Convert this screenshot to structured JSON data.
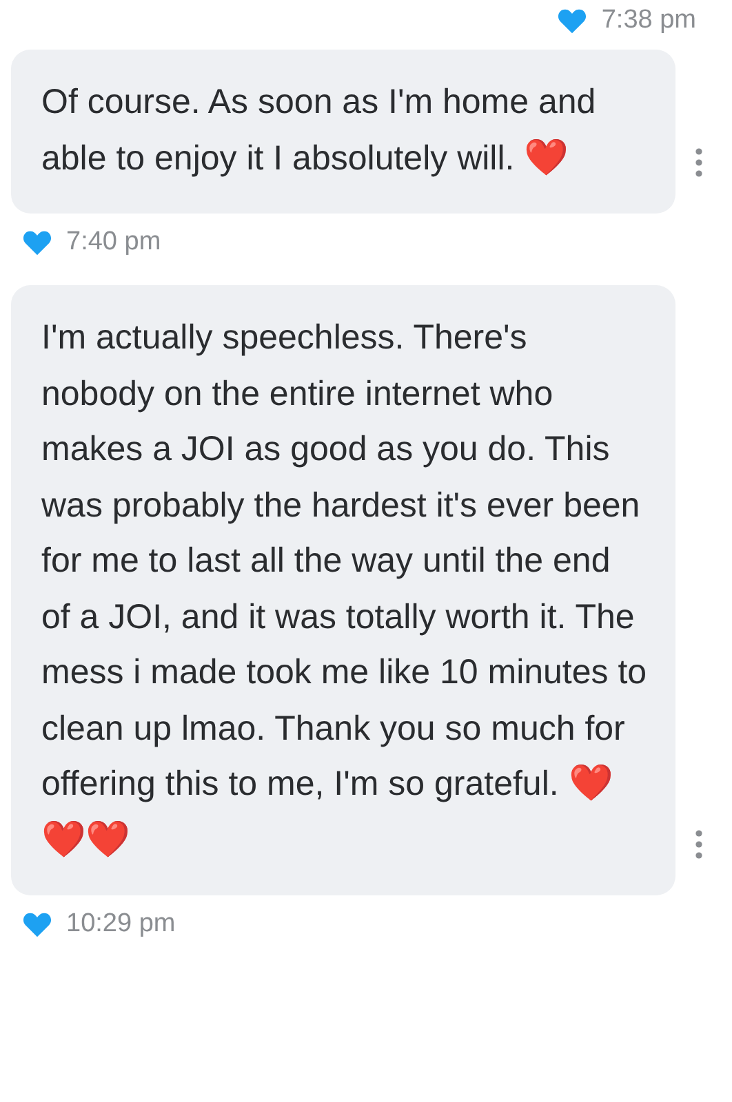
{
  "feed": [
    {
      "kind": "timeright",
      "liked": true,
      "time": "7:38 pm"
    },
    {
      "kind": "message",
      "text": "Of course. As soon as I'm home and able to enjoy it I absolutely will.",
      "emoji": "❤️"
    },
    {
      "kind": "timeleft",
      "liked": true,
      "time": "7:40 pm"
    },
    {
      "kind": "message",
      "text": "I'm actually speechless. There's nobody on the entire internet who makes a JOI as good as you do. This was probably the hardest it's ever been for me to last all the way until the end of a JOI, and it was totally worth it. The mess i made took me like 10 minutes to clean up lmao. Thank you so much for offering this to me, I'm so grateful.",
      "emoji": "❤️❤️❤️"
    },
    {
      "kind": "timeleft",
      "liked": true,
      "time": "10:29 pm"
    }
  ]
}
